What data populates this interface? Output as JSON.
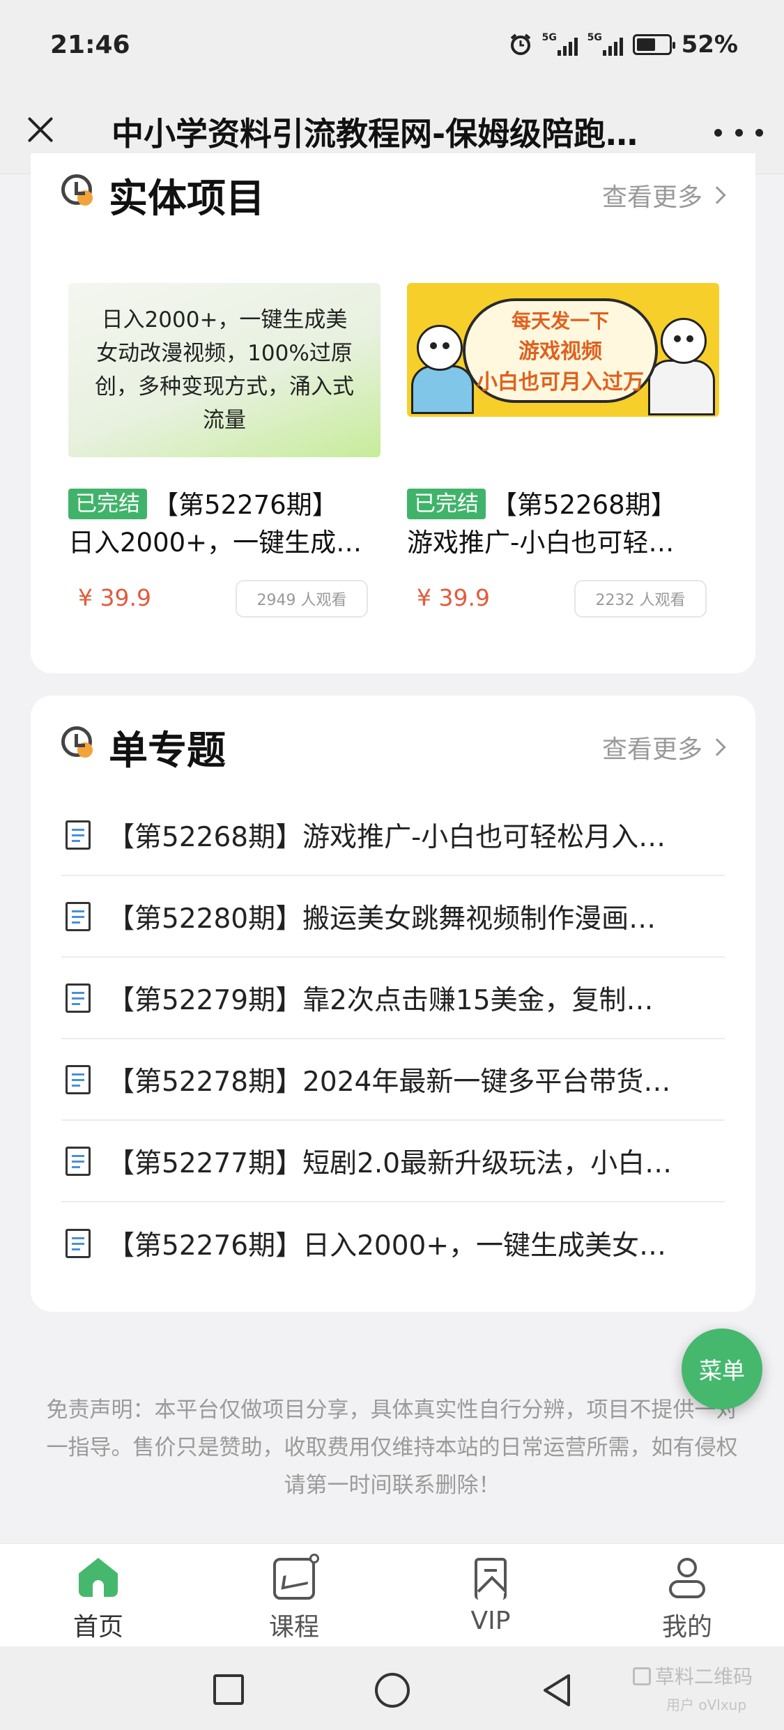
{
  "status_bar": {
    "time": "21:46",
    "network_1": "5G",
    "network_2": "5G",
    "battery": "52%",
    "icons": [
      "alarm-icon",
      "signal-icon",
      "signal-icon",
      "battery-charging-icon"
    ]
  },
  "header": {
    "title": "中小学资料引流教程网-保姆级陪跑…",
    "close_icon": "close-icon",
    "more_icon": "more-icon"
  },
  "section_projects": {
    "title": "实体项目",
    "see_more": "查看更多",
    "products": [
      {
        "thumb_text": "日入2000+，一键生成美女动改漫视频，100%过原创，多种变现方式，涌入式流量",
        "tag": "已完结",
        "title_line1": "【第52276期】",
        "title_line2": "日入2000+，一键生成…",
        "price": "¥ 39.9",
        "viewers": "2949 人观看"
      },
      {
        "thumb_line1": "每天发一下",
        "thumb_line2": "游戏视频",
        "thumb_line3": "小白也可月入过万",
        "tag": "已完结",
        "title_line1": "【第52268期】",
        "title_line2": "游戏推广-小白也可轻…",
        "price": "¥ 39.9",
        "viewers": "2232 人观看"
      }
    ]
  },
  "section_topics": {
    "title": "单专题",
    "see_more": "查看更多",
    "items": [
      "【第52268期】游戏推广-小白也可轻松月入…",
      "【第52280期】搬运美女跳舞视频制作漫画…",
      "【第52279期】靠2次点击赚15美金，复制…",
      "【第52278期】2024年最新一键多平台带货…",
      "【第52277期】短剧2.0最新升级玩法，小白…",
      "【第52276期】日入2000+，一键生成美女…"
    ]
  },
  "fab": {
    "label": "菜单"
  },
  "disclaimer": "免责声明：本平台仅做项目分享，具体真实性自行分辨，项目不提供一对一指导。售价只是赞助，收取费用仅维持本站的日常运营所需，如有侵权请第一时间联系删除！",
  "tabbar": {
    "tabs": [
      {
        "label": "首页",
        "icon": "home-icon",
        "active": true
      },
      {
        "label": "课程",
        "icon": "course-icon"
      },
      {
        "label": "VIP",
        "icon": "bookmark-icon"
      },
      {
        "label": "我的",
        "icon": "user-icon"
      }
    ],
    "active_color": "#45b86e"
  },
  "watermark": {
    "line1": "草料二维码",
    "line2": "用户 oVlxup"
  },
  "colors": {
    "accent": "#45b86e",
    "price": "#e35a3c",
    "tag_bg": "#40b36a"
  }
}
